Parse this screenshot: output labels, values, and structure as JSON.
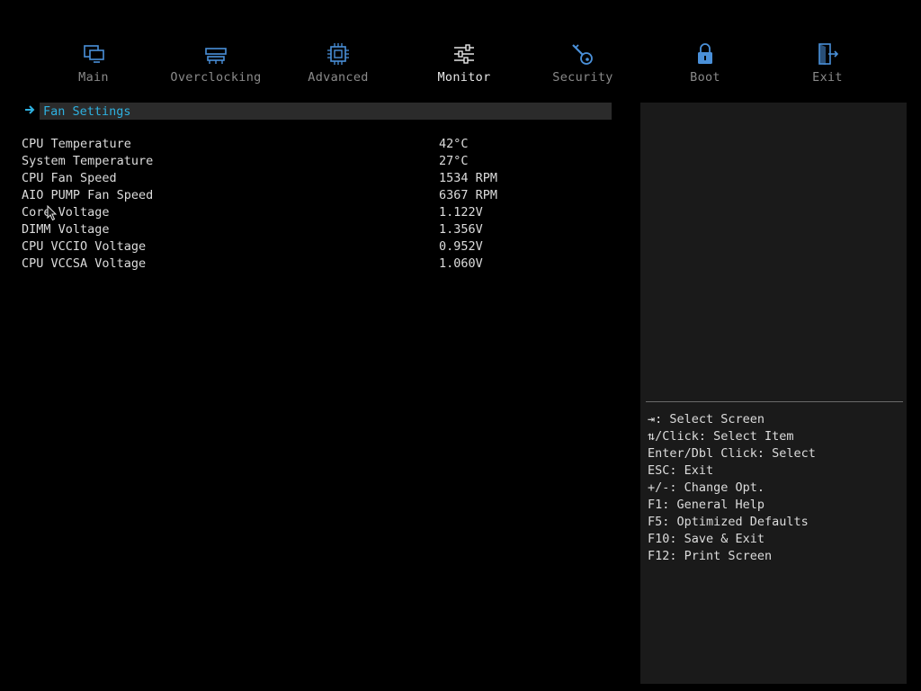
{
  "nav": {
    "tabs": [
      {
        "label": "Main",
        "icon": "computer-icon",
        "active": false
      },
      {
        "label": "Overclocking",
        "icon": "memory-icon",
        "active": false
      },
      {
        "label": "Advanced",
        "icon": "chip-icon",
        "active": false
      },
      {
        "label": "Monitor",
        "icon": "sliders-icon",
        "active": true
      },
      {
        "label": "Security",
        "icon": "key-icon",
        "active": false
      },
      {
        "label": "Boot",
        "icon": "lock-icon",
        "active": false
      },
      {
        "label": "Exit",
        "icon": "exit-door-icon",
        "active": false
      }
    ]
  },
  "submenu": {
    "fan_settings": "Fan Settings"
  },
  "readings": [
    {
      "label": "CPU Temperature",
      "value": "42°C"
    },
    {
      "label": "System Temperature",
      "value": "27°C"
    },
    {
      "label": "CPU Fan Speed",
      "value": "1534 RPM"
    },
    {
      "label": "AIO PUMP Fan Speed",
      "value": "6367 RPM"
    },
    {
      "label": "Core Voltage",
      "value": "1.122V"
    },
    {
      "label": "DIMM Voltage",
      "value": "1.356V"
    },
    {
      "label": "CPU VCCIO Voltage",
      "value": "0.952V"
    },
    {
      "label": "CPU VCCSA Voltage",
      "value": "1.060V"
    }
  ],
  "help": [
    "⇥: Select Screen",
    "⇅/Click: Select Item",
    "Enter/Dbl Click: Select",
    "ESC: Exit",
    "+/-: Change Opt.",
    "F1: General Help",
    "F5: Optimized Defaults",
    "F10: Save & Exit",
    "F12: Print Screen"
  ],
  "colors": {
    "background": "#000000",
    "accent_blue": "#2eb1e0",
    "icon_blue": "#4a90d9",
    "panel": "#1a1a1a",
    "text": "#dcdcdc",
    "inactive_tab": "#8a8a8a"
  }
}
